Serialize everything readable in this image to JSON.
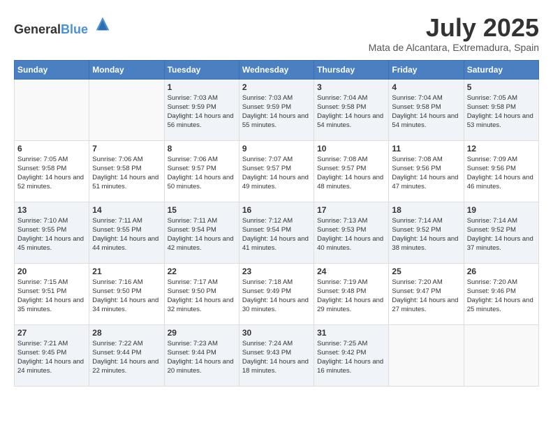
{
  "header": {
    "logo": {
      "general": "General",
      "blue": "Blue"
    },
    "title": "July 2025",
    "location": "Mata de Alcantara, Extremadura, Spain"
  },
  "calendar": {
    "days_of_week": [
      "Sunday",
      "Monday",
      "Tuesday",
      "Wednesday",
      "Thursday",
      "Friday",
      "Saturday"
    ],
    "weeks": [
      [
        {
          "day": "",
          "sunrise": "",
          "sunset": "",
          "daylight": ""
        },
        {
          "day": "",
          "sunrise": "",
          "sunset": "",
          "daylight": ""
        },
        {
          "day": "1",
          "sunrise": "Sunrise: 7:03 AM",
          "sunset": "Sunset: 9:59 PM",
          "daylight": "Daylight: 14 hours and 56 minutes."
        },
        {
          "day": "2",
          "sunrise": "Sunrise: 7:03 AM",
          "sunset": "Sunset: 9:59 PM",
          "daylight": "Daylight: 14 hours and 55 minutes."
        },
        {
          "day": "3",
          "sunrise": "Sunrise: 7:04 AM",
          "sunset": "Sunset: 9:58 PM",
          "daylight": "Daylight: 14 hours and 54 minutes."
        },
        {
          "day": "4",
          "sunrise": "Sunrise: 7:04 AM",
          "sunset": "Sunset: 9:58 PM",
          "daylight": "Daylight: 14 hours and 54 minutes."
        },
        {
          "day": "5",
          "sunrise": "Sunrise: 7:05 AM",
          "sunset": "Sunset: 9:58 PM",
          "daylight": "Daylight: 14 hours and 53 minutes."
        }
      ],
      [
        {
          "day": "6",
          "sunrise": "Sunrise: 7:05 AM",
          "sunset": "Sunset: 9:58 PM",
          "daylight": "Daylight: 14 hours and 52 minutes."
        },
        {
          "day": "7",
          "sunrise": "Sunrise: 7:06 AM",
          "sunset": "Sunset: 9:58 PM",
          "daylight": "Daylight: 14 hours and 51 minutes."
        },
        {
          "day": "8",
          "sunrise": "Sunrise: 7:06 AM",
          "sunset": "Sunset: 9:57 PM",
          "daylight": "Daylight: 14 hours and 50 minutes."
        },
        {
          "day": "9",
          "sunrise": "Sunrise: 7:07 AM",
          "sunset": "Sunset: 9:57 PM",
          "daylight": "Daylight: 14 hours and 49 minutes."
        },
        {
          "day": "10",
          "sunrise": "Sunrise: 7:08 AM",
          "sunset": "Sunset: 9:57 PM",
          "daylight": "Daylight: 14 hours and 48 minutes."
        },
        {
          "day": "11",
          "sunrise": "Sunrise: 7:08 AM",
          "sunset": "Sunset: 9:56 PM",
          "daylight": "Daylight: 14 hours and 47 minutes."
        },
        {
          "day": "12",
          "sunrise": "Sunrise: 7:09 AM",
          "sunset": "Sunset: 9:56 PM",
          "daylight": "Daylight: 14 hours and 46 minutes."
        }
      ],
      [
        {
          "day": "13",
          "sunrise": "Sunrise: 7:10 AM",
          "sunset": "Sunset: 9:55 PM",
          "daylight": "Daylight: 14 hours and 45 minutes."
        },
        {
          "day": "14",
          "sunrise": "Sunrise: 7:11 AM",
          "sunset": "Sunset: 9:55 PM",
          "daylight": "Daylight: 14 hours and 44 minutes."
        },
        {
          "day": "15",
          "sunrise": "Sunrise: 7:11 AM",
          "sunset": "Sunset: 9:54 PM",
          "daylight": "Daylight: 14 hours and 42 minutes."
        },
        {
          "day": "16",
          "sunrise": "Sunrise: 7:12 AM",
          "sunset": "Sunset: 9:54 PM",
          "daylight": "Daylight: 14 hours and 41 minutes."
        },
        {
          "day": "17",
          "sunrise": "Sunrise: 7:13 AM",
          "sunset": "Sunset: 9:53 PM",
          "daylight": "Daylight: 14 hours and 40 minutes."
        },
        {
          "day": "18",
          "sunrise": "Sunrise: 7:14 AM",
          "sunset": "Sunset: 9:52 PM",
          "daylight": "Daylight: 14 hours and 38 minutes."
        },
        {
          "day": "19",
          "sunrise": "Sunrise: 7:14 AM",
          "sunset": "Sunset: 9:52 PM",
          "daylight": "Daylight: 14 hours and 37 minutes."
        }
      ],
      [
        {
          "day": "20",
          "sunrise": "Sunrise: 7:15 AM",
          "sunset": "Sunset: 9:51 PM",
          "daylight": "Daylight: 14 hours and 35 minutes."
        },
        {
          "day": "21",
          "sunrise": "Sunrise: 7:16 AM",
          "sunset": "Sunset: 9:50 PM",
          "daylight": "Daylight: 14 hours and 34 minutes."
        },
        {
          "day": "22",
          "sunrise": "Sunrise: 7:17 AM",
          "sunset": "Sunset: 9:50 PM",
          "daylight": "Daylight: 14 hours and 32 minutes."
        },
        {
          "day": "23",
          "sunrise": "Sunrise: 7:18 AM",
          "sunset": "Sunset: 9:49 PM",
          "daylight": "Daylight: 14 hours and 30 minutes."
        },
        {
          "day": "24",
          "sunrise": "Sunrise: 7:19 AM",
          "sunset": "Sunset: 9:48 PM",
          "daylight": "Daylight: 14 hours and 29 minutes."
        },
        {
          "day": "25",
          "sunrise": "Sunrise: 7:20 AM",
          "sunset": "Sunset: 9:47 PM",
          "daylight": "Daylight: 14 hours and 27 minutes."
        },
        {
          "day": "26",
          "sunrise": "Sunrise: 7:20 AM",
          "sunset": "Sunset: 9:46 PM",
          "daylight": "Daylight: 14 hours and 25 minutes."
        }
      ],
      [
        {
          "day": "27",
          "sunrise": "Sunrise: 7:21 AM",
          "sunset": "Sunset: 9:45 PM",
          "daylight": "Daylight: 14 hours and 24 minutes."
        },
        {
          "day": "28",
          "sunrise": "Sunrise: 7:22 AM",
          "sunset": "Sunset: 9:44 PM",
          "daylight": "Daylight: 14 hours and 22 minutes."
        },
        {
          "day": "29",
          "sunrise": "Sunrise: 7:23 AM",
          "sunset": "Sunset: 9:44 PM",
          "daylight": "Daylight: 14 hours and 20 minutes."
        },
        {
          "day": "30",
          "sunrise": "Sunrise: 7:24 AM",
          "sunset": "Sunset: 9:43 PM",
          "daylight": "Daylight: 14 hours and 18 minutes."
        },
        {
          "day": "31",
          "sunrise": "Sunrise: 7:25 AM",
          "sunset": "Sunset: 9:42 PM",
          "daylight": "Daylight: 14 hours and 16 minutes."
        },
        {
          "day": "",
          "sunrise": "",
          "sunset": "",
          "daylight": ""
        },
        {
          "day": "",
          "sunrise": "",
          "sunset": "",
          "daylight": ""
        }
      ]
    ]
  }
}
